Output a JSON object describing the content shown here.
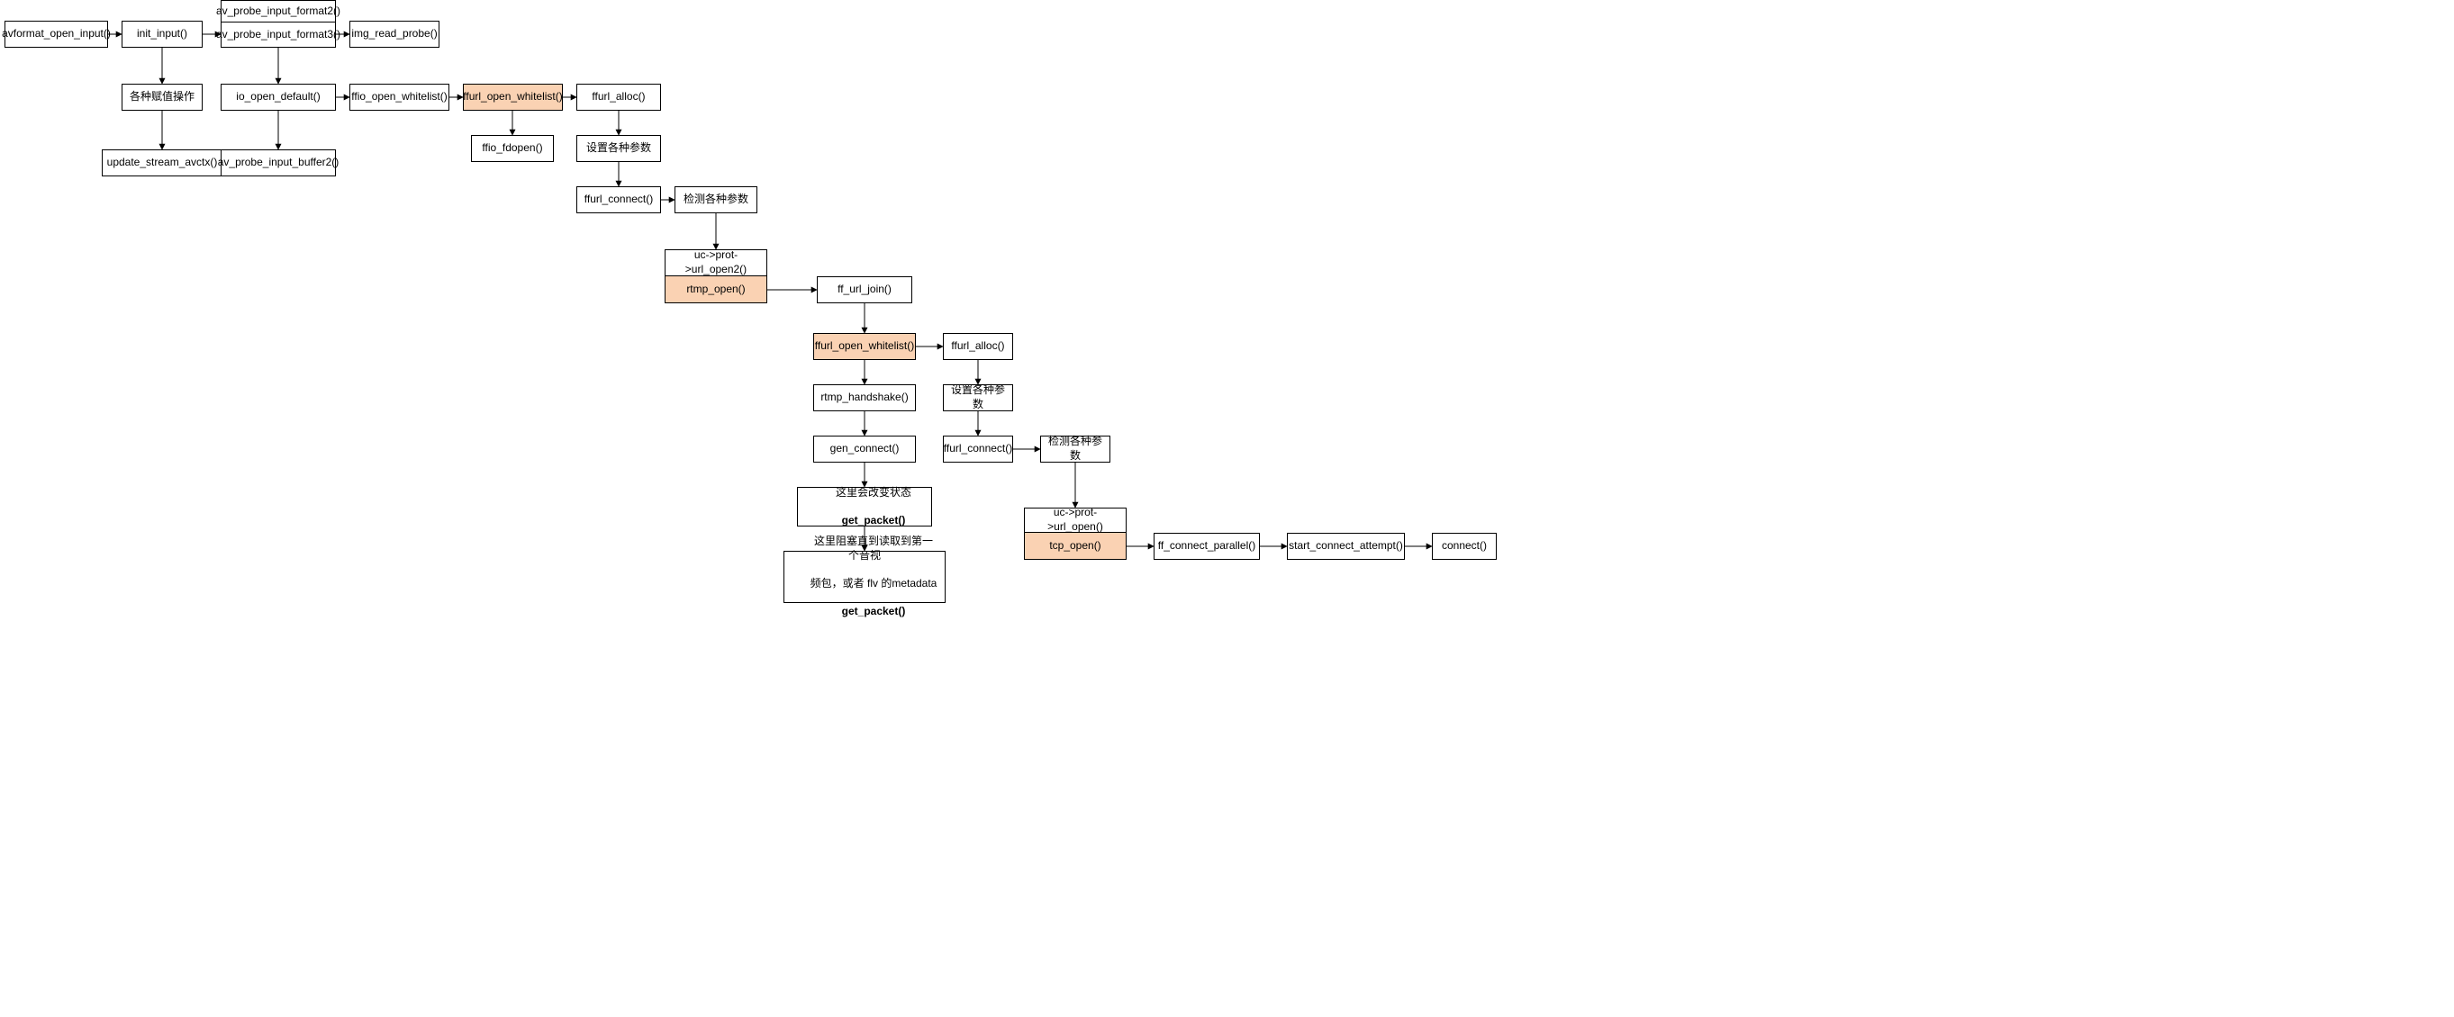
{
  "chart_data": {
    "type": "flowchart",
    "title": "",
    "nodes": [
      {
        "id": "n1",
        "label": "avformat_open_input()"
      },
      {
        "id": "n2",
        "label": "init_input()"
      },
      {
        "id": "n3",
        "label": "av_probe_input_format2()"
      },
      {
        "id": "n4",
        "label": "av_probe_input_format3()"
      },
      {
        "id": "n5",
        "label": "img_read_probe()"
      },
      {
        "id": "n6",
        "label": "各种赋值操作"
      },
      {
        "id": "n7",
        "label": "update_stream_avctx()"
      },
      {
        "id": "n8",
        "label": "io_open_default()"
      },
      {
        "id": "n9",
        "label": "av_probe_input_buffer2()"
      },
      {
        "id": "n10",
        "label": "ffio_open_whitelist()"
      },
      {
        "id": "n11",
        "label": "ffurl_open_whitelist()",
        "highlight": true
      },
      {
        "id": "n12",
        "label": "ffio_fdopen()"
      },
      {
        "id": "n13",
        "label": "ffurl_alloc()"
      },
      {
        "id": "n14",
        "label": "设置各种参数"
      },
      {
        "id": "n15",
        "label": "ffurl_connect()"
      },
      {
        "id": "n16",
        "label": "检测各种参数"
      },
      {
        "id": "n17",
        "label": "uc->prot->url_open2()"
      },
      {
        "id": "n18",
        "label": "rtmp_open()",
        "highlight": true
      },
      {
        "id": "n19",
        "label": "ff_url_join()"
      },
      {
        "id": "n20",
        "label": "ffurl_open_whitelist()",
        "highlight": true
      },
      {
        "id": "n21",
        "label": "rtmp_handshake()"
      },
      {
        "id": "n22",
        "label": "gen_connect()"
      },
      {
        "id": "n23",
        "label": "这里会改变状态\nget_packet()"
      },
      {
        "id": "n24",
        "label": "这里阻塞直到读取到第一个音视\n频包，或者 flv 的metadata\nget_packet()"
      },
      {
        "id": "n25",
        "label": "ffurl_alloc()"
      },
      {
        "id": "n26",
        "label": "设置各种参数"
      },
      {
        "id": "n27",
        "label": "ffurl_connect()"
      },
      {
        "id": "n28",
        "label": "检测各种参数"
      },
      {
        "id": "n29",
        "label": "uc->prot->url_open()"
      },
      {
        "id": "n30",
        "label": "tcp_open()",
        "highlight": true
      },
      {
        "id": "n31",
        "label": "ff_connect_parallel()"
      },
      {
        "id": "n32",
        "label": "start_connect_attempt()"
      },
      {
        "id": "n33",
        "label": "connect()"
      }
    ],
    "edges": [
      [
        "n1",
        "n2"
      ],
      [
        "n2",
        "n4"
      ],
      [
        "n3",
        "n4"
      ],
      [
        "n4",
        "n5"
      ],
      [
        "n2",
        "n6"
      ],
      [
        "n6",
        "n7"
      ],
      [
        "n4",
        "n8"
      ],
      [
        "n8",
        "n9"
      ],
      [
        "n8",
        "n10"
      ],
      [
        "n10",
        "n11"
      ],
      [
        "n11",
        "n12"
      ],
      [
        "n11",
        "n13"
      ],
      [
        "n13",
        "n14"
      ],
      [
        "n14",
        "n15"
      ],
      [
        "n15",
        "n16"
      ],
      [
        "n16",
        "n17"
      ],
      [
        "n17",
        "n18"
      ],
      [
        "n18",
        "n19"
      ],
      [
        "n19",
        "n20"
      ],
      [
        "n20",
        "n21"
      ],
      [
        "n21",
        "n22"
      ],
      [
        "n22",
        "n23"
      ],
      [
        "n23",
        "n24"
      ],
      [
        "n20",
        "n25"
      ],
      [
        "n25",
        "n26"
      ],
      [
        "n26",
        "n27"
      ],
      [
        "n27",
        "n28"
      ],
      [
        "n28",
        "n29"
      ],
      [
        "n29",
        "n30"
      ],
      [
        "n30",
        "n31"
      ],
      [
        "n31",
        "n32"
      ],
      [
        "n32",
        "n33"
      ]
    ]
  },
  "nodes": {
    "n1": "avformat_open_input()",
    "n2": "init_input()",
    "n3": "av_probe_input_format2()",
    "n4": "av_probe_input_format3()",
    "n5": "img_read_probe()",
    "n6": "各种赋值操作",
    "n7": "update_stream_avctx()",
    "n8": "io_open_default()",
    "n9": "av_probe_input_buffer2()",
    "n10": "ffio_open_whitelist()",
    "n11": "ffurl_open_whitelist()",
    "n12": "ffio_fdopen()",
    "n13": "ffurl_alloc()",
    "n14": "设置各种参数",
    "n15": "ffurl_connect()",
    "n16": "检测各种参数",
    "n17": "uc->prot->url_open2()",
    "n18": "rtmp_open()",
    "n19": "ff_url_join()",
    "n20": "ffurl_open_whitelist()",
    "n21": "rtmp_handshake()",
    "n22": "gen_connect()",
    "n23_l1": "这里会改变状态",
    "n23_l2": "get_packet()",
    "n24_l1": "这里阻塞直到读取到第一个音视",
    "n24_l2": "频包，或者 flv 的metadata",
    "n24_l3": "get_packet()",
    "n25": "ffurl_alloc()",
    "n26": "设置各种参数",
    "n27": "ffurl_connect()",
    "n28": "检测各种参数",
    "n29": "uc->prot->url_open()",
    "n30": "tcp_open()",
    "n31": "ff_connect_parallel()",
    "n32": "start_connect_attempt()",
    "n33": "connect()"
  }
}
